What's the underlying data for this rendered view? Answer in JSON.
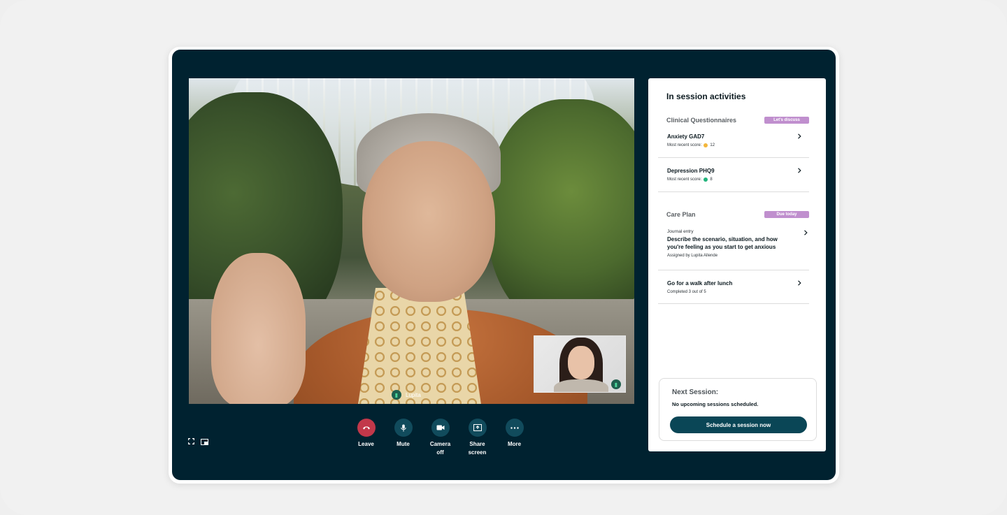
{
  "video": {
    "speaker_name": "Lupita"
  },
  "controls": [
    {
      "label": "Leave",
      "icon": "phone-hangup-icon"
    },
    {
      "label": "Mute",
      "icon": "microphone-icon"
    },
    {
      "label": "Camera off",
      "icon": "camera-icon"
    },
    {
      "label": "Share screen",
      "icon": "share-screen-icon"
    },
    {
      "label": "More",
      "icon": "more-dots-icon"
    }
  ],
  "panel": {
    "title": "In session activities",
    "questionnaires": {
      "heading": "Clinical Questionnaires",
      "badge": "Let's discuss",
      "items": [
        {
          "title": "Anxiety GAD7",
          "score_label": "Most recent score:",
          "score": "12",
          "score_color": "#f3b63b"
        },
        {
          "title": "Depression PHQ9",
          "score_label": "Most recent score:",
          "score": "8",
          "score_color": "#22b47c"
        }
      ]
    },
    "care_plan": {
      "heading": "Care Plan",
      "badge": "Due today",
      "items": [
        {
          "kicker": "Journal entry",
          "title": "Describe the scenario, situation, and how you're feeling as you start to get anxious",
          "sub": "Assigned by Lupita Allende"
        },
        {
          "title": "Go for a walk after lunch",
          "sub": "Completed 3 out of 5"
        }
      ]
    },
    "next_session": {
      "label": "Next Session:",
      "status": "No upcoming sessions scheduled.",
      "button": "Schedule a session now"
    }
  },
  "colors": {
    "app_bg": "#002230",
    "badge": "#c08fce",
    "leave": "#c2384a",
    "control": "#114b5c",
    "primary_button": "#0a4656"
  }
}
